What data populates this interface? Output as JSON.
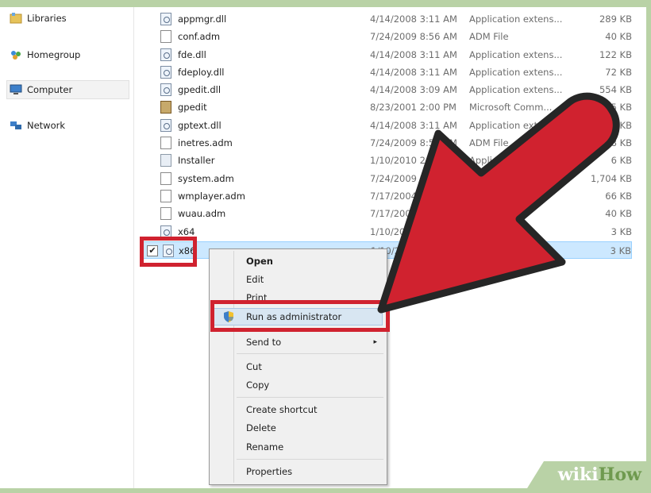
{
  "nav": {
    "items": [
      {
        "label": "Libraries",
        "icon": "libraries-icon"
      },
      {
        "label": "Homegroup",
        "icon": "homegroup-icon"
      },
      {
        "label": "Computer",
        "icon": "computer-icon"
      },
      {
        "label": "Network",
        "icon": "network-icon"
      }
    ]
  },
  "files": [
    {
      "name": "appmgr.dll",
      "date": "4/14/2008 3:11 AM",
      "type": "Application extens...",
      "size": "289 KB",
      "icon": "dll-file-icon"
    },
    {
      "name": "conf.adm",
      "date": "7/24/2009 8:56 AM",
      "type": "ADM File",
      "size": "40 KB",
      "icon": "document-icon"
    },
    {
      "name": "fde.dll",
      "date": "4/14/2008 3:11 AM",
      "type": "Application extens...",
      "size": "122 KB",
      "icon": "dll-file-icon"
    },
    {
      "name": "fdeploy.dll",
      "date": "4/14/2008 3:11 AM",
      "type": "Application extens...",
      "size": "72 KB",
      "icon": "dll-file-icon"
    },
    {
      "name": "gpedit.dll",
      "date": "4/14/2008 3:09 AM",
      "type": "Application extens...",
      "size": "554 KB",
      "icon": "dll-file-icon"
    },
    {
      "name": "gpedit",
      "date": "8/23/2001 2:00 PM",
      "type": "Microsoft Comm...",
      "size": "35 KB",
      "icon": "gpedit-icon"
    },
    {
      "name": "gptext.dll",
      "date": "4/14/2008 3:11 AM",
      "type": "Application extens...",
      "size": "85 KB",
      "icon": "dll-file-icon"
    },
    {
      "name": "inetres.adm",
      "date": "7/24/2009 8:57 AM",
      "type": "ADM File",
      "size": "8 KB",
      "icon": "document-icon"
    },
    {
      "name": "Installer",
      "date": "1/10/2010 2:22 PM",
      "type": "Application",
      "size": "6 KB",
      "icon": "installer-icon"
    },
    {
      "name": "system.adm",
      "date": "7/24/2009 8:56 AM",
      "type": "ADM File",
      "size": "1,704 KB",
      "icon": "document-icon"
    },
    {
      "name": "wmplayer.adm",
      "date": "7/17/2004 11:",
      "type": "ADM File",
      "size": "66 KB",
      "icon": "document-icon"
    },
    {
      "name": "wuau.adm",
      "date": "7/17/2004 1",
      "type": "ADM File",
      "size": "40 KB",
      "icon": "document-icon"
    },
    {
      "name": "x64",
      "date": "1/10/2010",
      "type": "",
      "size": "3 KB",
      "icon": "x64-file-icon"
    },
    {
      "name": "x86",
      "date": "1/10/2010",
      "type": "",
      "size": "3 KB",
      "icon": "x86-file-icon"
    }
  ],
  "context_menu": {
    "open": "Open",
    "edit": "Edit",
    "print": "Print",
    "run_as_admin": "Run as administrator",
    "send_to": "Send to",
    "cut": "Cut",
    "copy": "Copy",
    "create_shortcut": "Create shortcut",
    "delete": "Delete",
    "rename": "Rename",
    "properties": "Properties"
  },
  "checkbox_mark": "✔",
  "submenu_arrow": "▸",
  "watermark": {
    "part1": "wiki",
    "part2": "How"
  },
  "colors": {
    "highlight": "#d0222f",
    "arrow": "#d0222f",
    "selection": "#cce8ff",
    "frame": "#b9d2a6"
  }
}
